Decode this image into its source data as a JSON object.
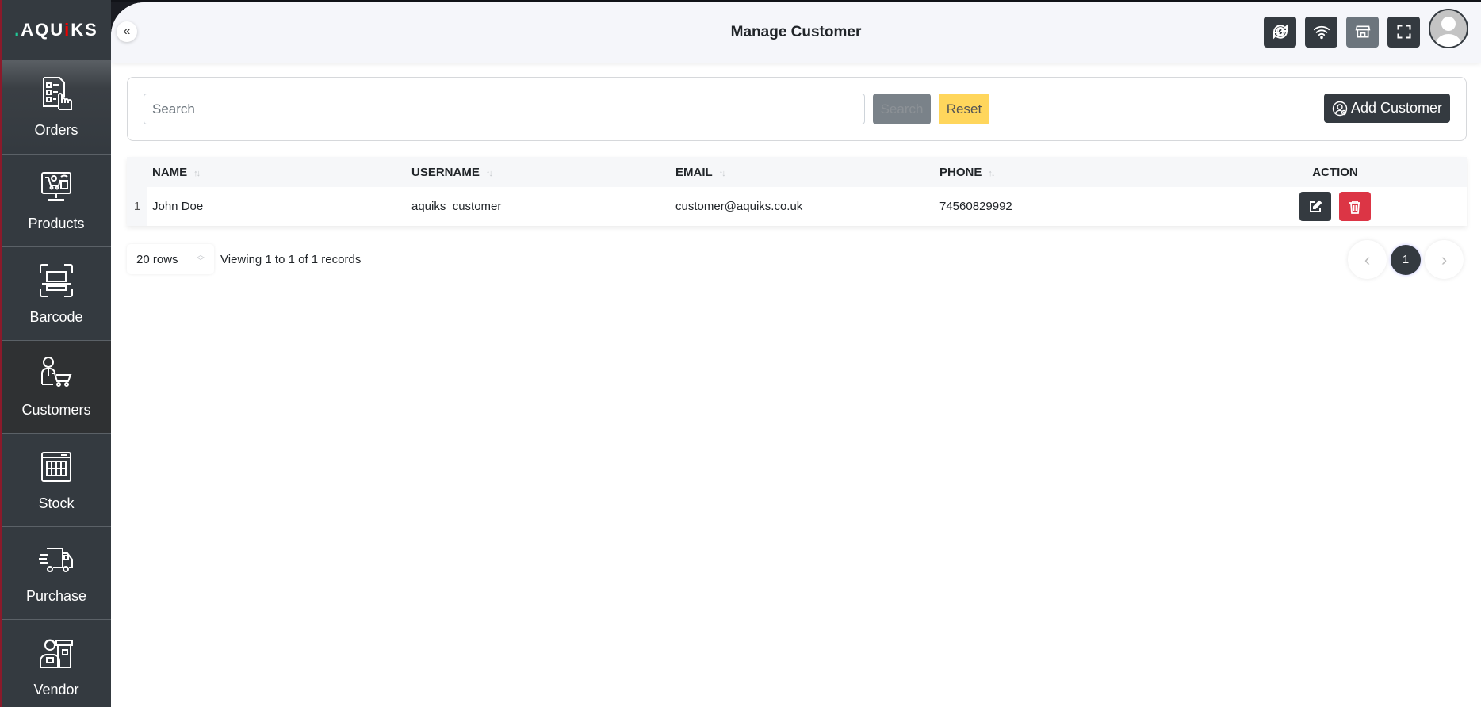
{
  "brand": {
    "logo_text": "AQUiKS",
    "logo_parts": [
      "",
      "AQU",
      "i",
      "KS"
    ]
  },
  "sidebar": {
    "items": [
      {
        "label": "Orders",
        "icon": "orders-checklist-icon"
      },
      {
        "label": "Products",
        "icon": "products-monitor-cart-icon"
      },
      {
        "label": "Barcode",
        "icon": "barcode-scan-icon"
      },
      {
        "label": "Customers",
        "icon": "customer-cart-icon",
        "active": true
      },
      {
        "label": "Stock",
        "icon": "stock-grid-icon"
      },
      {
        "label": "Purchase",
        "icon": "purchase-truck-icon"
      },
      {
        "label": "Vendor",
        "icon": "vendor-store-icon"
      }
    ]
  },
  "header": {
    "title": "Manage Customer",
    "collapse_icon": "«",
    "actions": [
      "sync-icon",
      "wifi-icon",
      "store-icon",
      "fullscreen-icon"
    ]
  },
  "search": {
    "placeholder": "Search",
    "value": "",
    "search_label": "Search",
    "reset_label": "Reset",
    "add_label": "Add Customer"
  },
  "table": {
    "columns": [
      "NAME",
      "USERNAME",
      "EMAIL",
      "PHONE",
      "ACTION"
    ],
    "sort_glyph": "↑↓",
    "rows": [
      {
        "index": "1",
        "name": "John Doe",
        "username": "aquiks_customer",
        "email": "customer@aquiks.co.uk",
        "phone": "74560829992"
      }
    ]
  },
  "footer": {
    "rows_per_page": "20 rows",
    "viewing": "Viewing 1 to 1 of 1 records",
    "prev": "‹",
    "current_page": "1",
    "next": "›"
  },
  "colors": {
    "sidebar_bg": "#343a40",
    "active_item_bg": "#2f3133",
    "dark_button": "#343a40",
    "danger": "#dc3545",
    "warning": "#ffd65c",
    "secondary": "#6c757d",
    "brand_green": "#20c997",
    "brand_red": "#ee0000"
  }
}
